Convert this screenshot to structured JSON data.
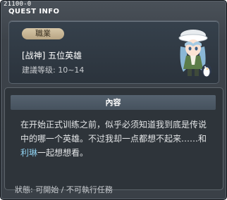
{
  "window": {
    "quest_id": "21100-0",
    "title": "QUEST INFO"
  },
  "header": {
    "job_badge": "職業",
    "quest_name": "[战神] 五位英雄",
    "level_requirement": "建議等级: 10~14"
  },
  "content": {
    "header": "內容",
    "text_before": "在开始正式训练之前，似乎必须知道我到底是传说中的哪一个英雄。不过我却一点都想不起来……和",
    "npc_name": "利琳",
    "text_after": "一起想想看。"
  },
  "status": {
    "text": "狀態: 可開始 / 不可執行任務"
  },
  "colors": {
    "window_bg": "#3d434a",
    "panel_bg": "#2e343a",
    "badge_bg": "#c8b693",
    "npc_link": "#8fd1f0"
  }
}
